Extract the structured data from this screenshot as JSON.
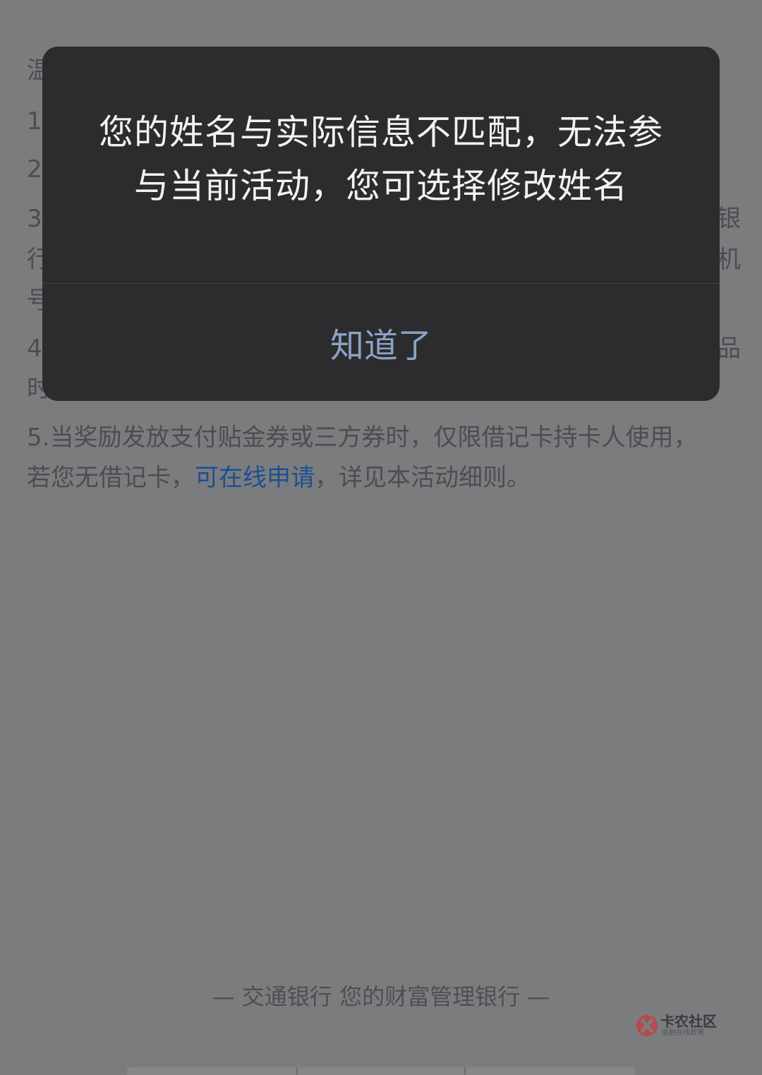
{
  "background": {
    "notice_heading_visible": "温",
    "item_1_visible": "1.",
    "item_2_visible": "2.",
    "item_3_line1_visible": "3.",
    "item_3_line2_visible": "行",
    "item_3_line3_visible": "号",
    "item_3_line1_right": "银",
    "item_3_line2_right": "机",
    "item_4_line1_visible": "4.",
    "item_4_line2_visible": "时",
    "item_4_line1_right": "品",
    "item_5_line1": "5.当奖励发放支付贴金券或三方券时，仅限借记卡持卡人使用，",
    "item_5_line2_before_link": "若您无借记卡，",
    "item_5_link": "可在线申请",
    "item_5_line2_after_link": "，详见本活动细则。",
    "footer_slogan": "— 交通银行 您的财富管理银行 —"
  },
  "watermark": {
    "title": "卡农社区",
    "subtitle": "金融在线教育"
  },
  "dialog": {
    "message_line1": "您的姓名与实际信息不匹配，无法参",
    "message_line2": "与当前活动，您可选择修改姓名",
    "confirm_label": "知道了"
  },
  "colors": {
    "overlay_background": "#7b7c7e",
    "dialog_background": "#2c2c2e",
    "dialog_text": "#f2f2f2",
    "confirm_text": "#8aa3c6",
    "link_text": "#1b4f94"
  }
}
